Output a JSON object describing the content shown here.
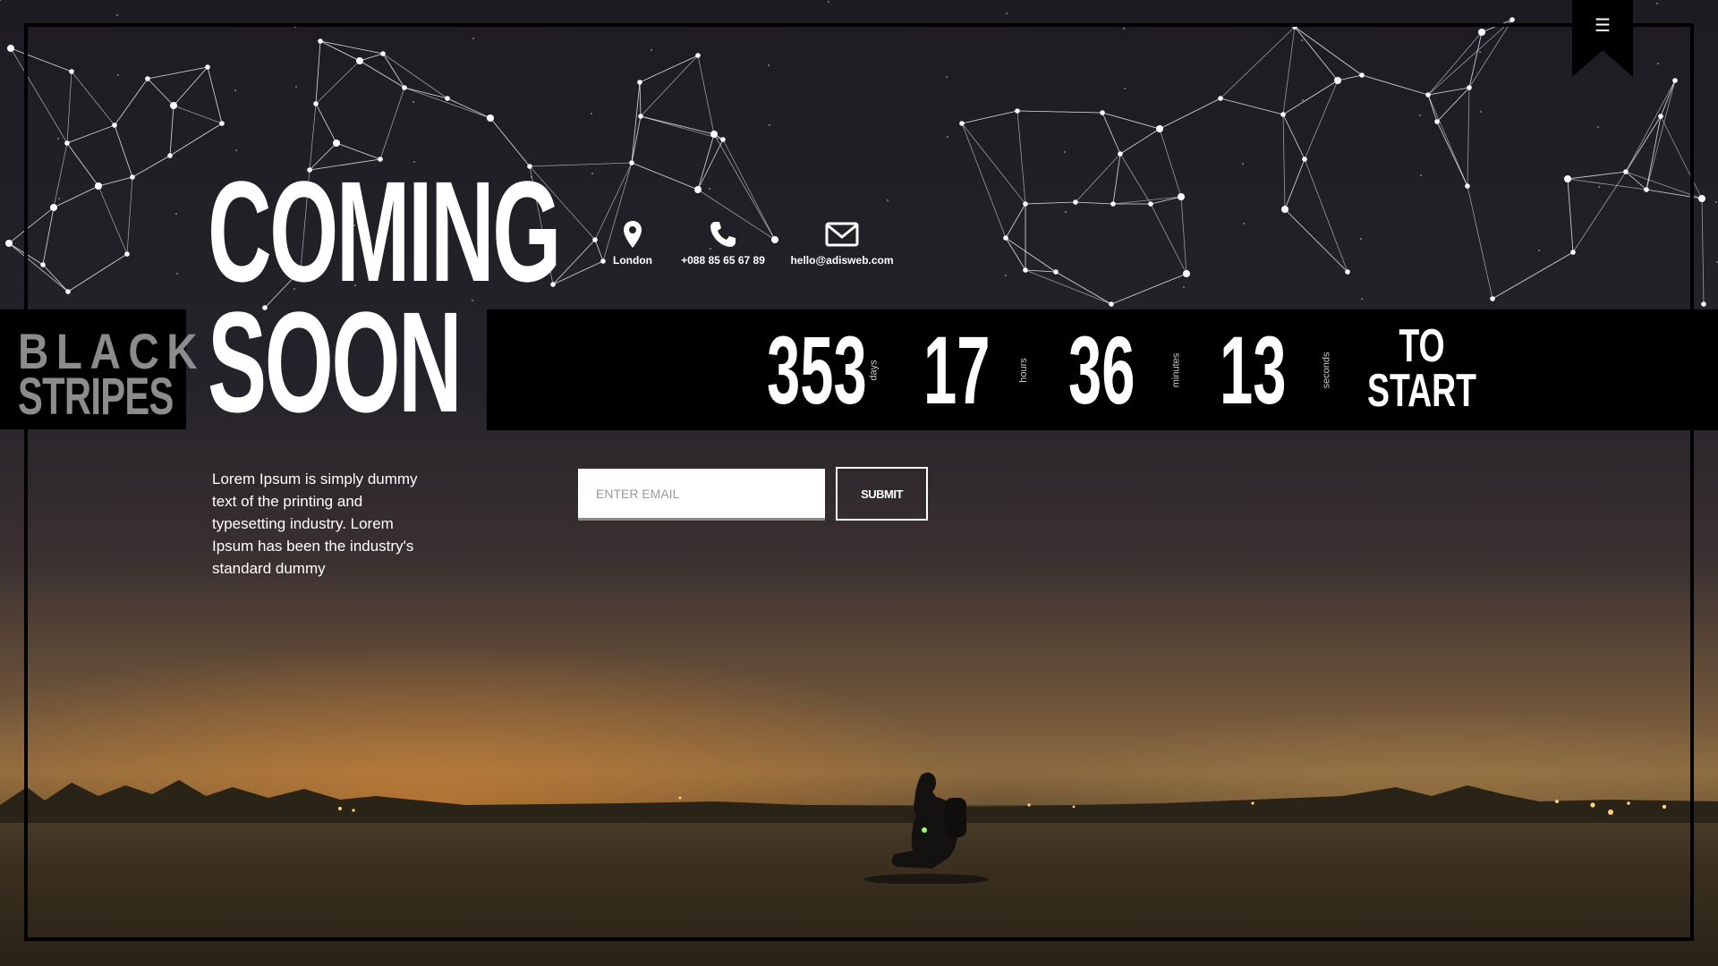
{
  "header": {
    "menu_icon": "hamburger-icon"
  },
  "contacts": [
    {
      "icon": "map-pin-icon",
      "label": "London"
    },
    {
      "icon": "phone-icon",
      "label": "+088 85 65 67 89"
    },
    {
      "icon": "envelope-icon",
      "label": "hello@adisweb.com"
    }
  ],
  "hero": {
    "line1": "COMING",
    "line2": "SOON"
  },
  "logo": {
    "line1": "BLACK",
    "line2": "STRIPES"
  },
  "countdown": {
    "days": "353",
    "days_label": "days",
    "hours": "17",
    "hours_label": "hours",
    "minutes": "36",
    "minutes_label": "minutes",
    "seconds": "13",
    "seconds_label": "seconds",
    "to_label_1": "TO",
    "to_label_2": "START"
  },
  "description": "Lorem Ipsum is simply dummy text of the printing and typesetting industry. Lorem Ipsum has been the industry's standard dummy",
  "subscribe": {
    "placeholder": "ENTER EMAIL",
    "submit_label": "SUBMIT"
  },
  "colors": {
    "bar": "#000000",
    "logo_text": "#8c8c8c",
    "sky": "#1d1c22",
    "glow": "#e68c32"
  }
}
